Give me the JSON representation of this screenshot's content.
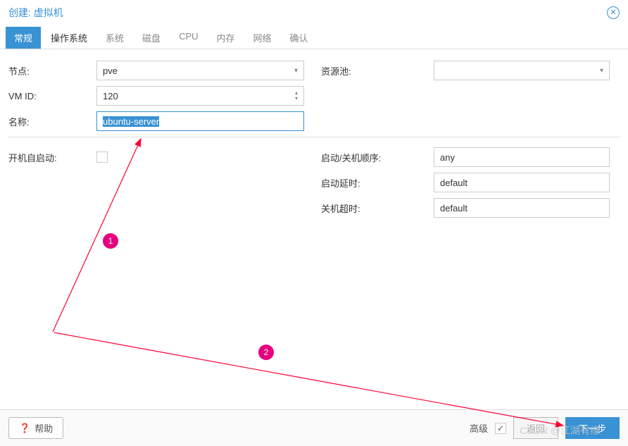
{
  "title": "创建: 虚拟机",
  "tabs": [
    "常规",
    "操作系统",
    "系统",
    "磁盘",
    "CPU",
    "内存",
    "网络",
    "确认"
  ],
  "form": {
    "node_label": "节点:",
    "node_value": "pve",
    "vmid_label": "VM ID:",
    "vmid_value": "120",
    "name_label": "名称:",
    "name_value": "ubuntu-server",
    "pool_label": "资源池:",
    "pool_value": "",
    "autostart_label": "开机自启动:",
    "order_label": "启动/关机顺序:",
    "order_value": "any",
    "startdelay_label": "启动延时:",
    "startdelay_value": "default",
    "shutdown_label": "关机超时:",
    "shutdown_value": "default"
  },
  "footer": {
    "help": "帮助",
    "advanced": "高级",
    "back": "返回",
    "next": "下一步"
  },
  "annotations": {
    "n1": "1",
    "n2": "2"
  },
  "watermark": "CSDN @江湖有缘"
}
